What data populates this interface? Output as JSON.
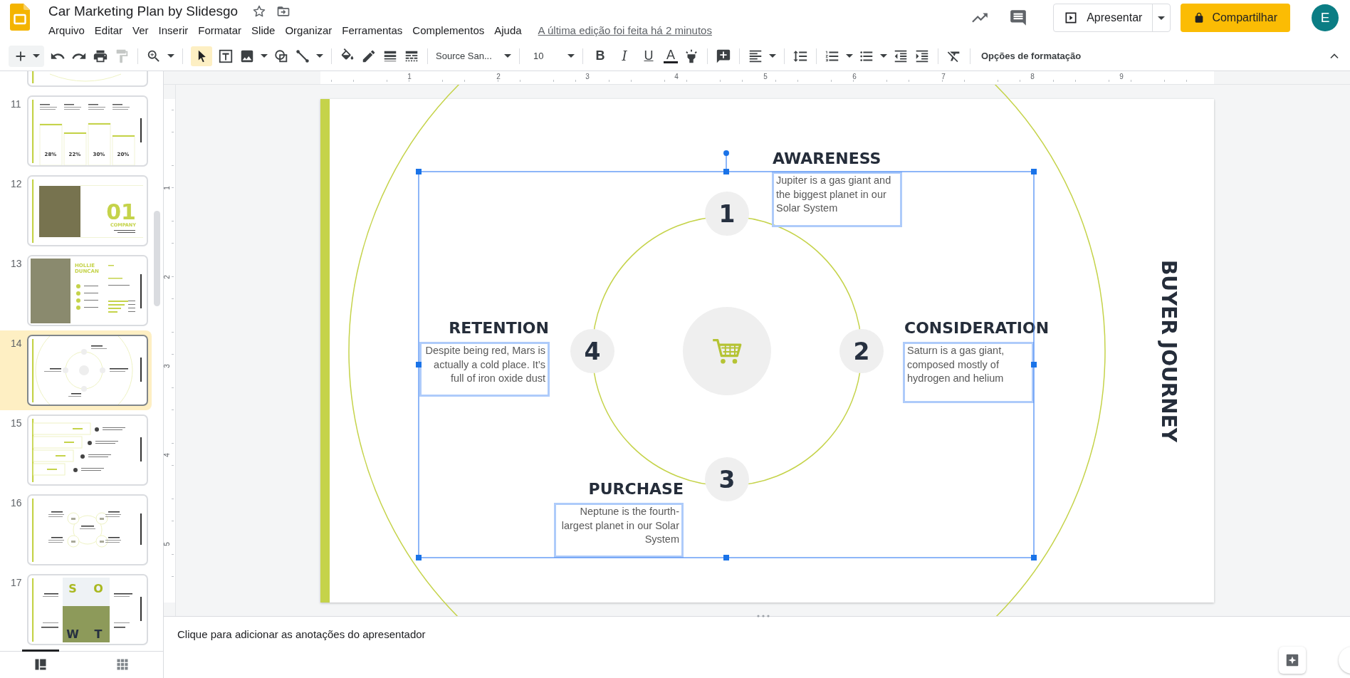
{
  "document": {
    "title": "Car Marketing Plan by Slidesgo",
    "starred": false
  },
  "menu": [
    "Arquivo",
    "Editar",
    "Ver",
    "Inserir",
    "Formatar",
    "Slide",
    "Organizar",
    "Ferramentas",
    "Complementos",
    "Ajuda"
  ],
  "last_edit": "A última edição foi feita há 2 minutos",
  "header_actions": {
    "present": "Apresentar",
    "share": "Compartilhar",
    "avatar": "E"
  },
  "toolbar": {
    "pointer_selected": true,
    "font": "Source San...",
    "font_size": "10",
    "text_format": [
      {
        "kind": "bold",
        "label": "B"
      },
      {
        "kind": "italic",
        "label": "I"
      },
      {
        "kind": "underline",
        "label": "U"
      },
      {
        "kind": "color",
        "label": "A"
      }
    ],
    "format_options": "Opções de formatação"
  },
  "ruler": {
    "horizontal": [
      "1",
      "2",
      "3",
      "4",
      "5",
      "6",
      "7",
      "8",
      "9"
    ],
    "vertical": [
      "1",
      "2",
      "3",
      "4",
      "5"
    ]
  },
  "slides": [
    {
      "kind": "partial",
      "selected": false
    },
    {
      "number": "11",
      "kind": "bars",
      "selected": false,
      "texts": [
        "28%",
        "22%",
        "30%",
        "20%"
      ]
    },
    {
      "number": "12",
      "kind": "section",
      "selected": false,
      "texts": [
        "01",
        "COMPANY"
      ]
    },
    {
      "number": "13",
      "kind": "profile",
      "selected": false,
      "texts": [
        "HOLLIE DUNCAN"
      ]
    },
    {
      "number": "14",
      "kind": "cycle",
      "selected": true
    },
    {
      "number": "15",
      "kind": "funnel",
      "selected": false
    },
    {
      "number": "16",
      "kind": "ring",
      "selected": false
    },
    {
      "number": "17",
      "kind": "swot",
      "selected": false,
      "texts": [
        "S",
        "O",
        "W",
        "T"
      ]
    }
  ],
  "view_toggle": {
    "filmstrip_selected": true
  },
  "slide": {
    "title": "BUYER JOURNEY",
    "stages": [
      {
        "number": "1",
        "heading": "AWARENESS",
        "text": "Jupiter is a gas giant and the biggest planet in our Solar System"
      },
      {
        "number": "2",
        "heading": "CONSIDERATION",
        "text": "Saturn is a gas giant, composed mostly of hydrogen and helium"
      },
      {
        "number": "3",
        "heading": "PURCHASE",
        "text": "Neptune is the fourth-largest planet in our Solar System"
      },
      {
        "number": "4",
        "heading": "RETENTION",
        "text": "Despite being red, Mars is actually a cold place. It’s full of iron oxide dust"
      }
    ]
  },
  "notes_placeholder": "Clique para adicionar as anotações do apresentador"
}
